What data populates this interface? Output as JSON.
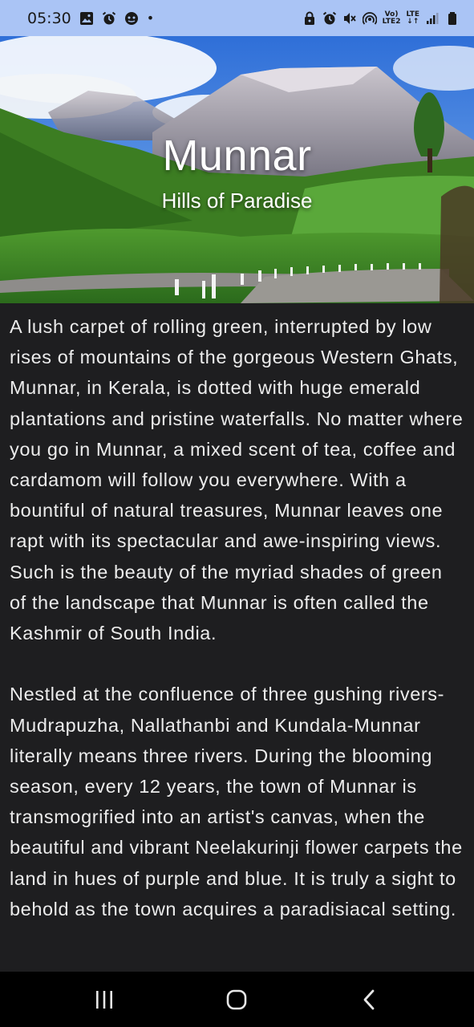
{
  "status_bar": {
    "time": "05:30",
    "dot": "•",
    "network_label_top": "Vo)",
    "network_label_bottom": "LTE2",
    "lte_label": "LTE",
    "icons_left": [
      "gallery-icon",
      "alarm-icon",
      "sync-icon"
    ],
    "icons_right": [
      "lock-icon",
      "alarm-icon",
      "mute-icon",
      "hotspot-icon",
      "volte-icon",
      "signal-icon",
      "battery-icon"
    ]
  },
  "hero": {
    "title": "Munnar",
    "subtitle": "Hills of Paradise"
  },
  "article": {
    "paragraphs": [
      "A lush carpet of rolling green, interrupted by low rises of mountains of the gorgeous Western Ghats, Munnar, in Kerala, is dotted with huge emerald plantations and pristine waterfalls. No matter where you go in Munnar, a mixed scent of tea, coffee and cardamom will follow you everywhere. With a bountiful of natural treasures, Munnar leaves one rapt with its spectacular and awe-inspiring views. Such is the beauty of the myriad shades of green of the landscape that Munnar is often called the Kashmir of South India.",
      "Nestled at the confluence of three gushing rivers- Mudrapuzha, Nallathanbi and Kundala-Munnar literally means three rivers. During the blooming season, every 12 years, the town of Munnar is transmogrified into an artist's canvas, when the beautiful and vibrant Neelakurinji flower carpets the land in hues of purple and blue. It is truly a sight to behold as the town acquires a paradisiacal setting."
    ]
  },
  "nav": {
    "recents": "recents-icon",
    "home": "home-icon",
    "back": "back-icon"
  }
}
